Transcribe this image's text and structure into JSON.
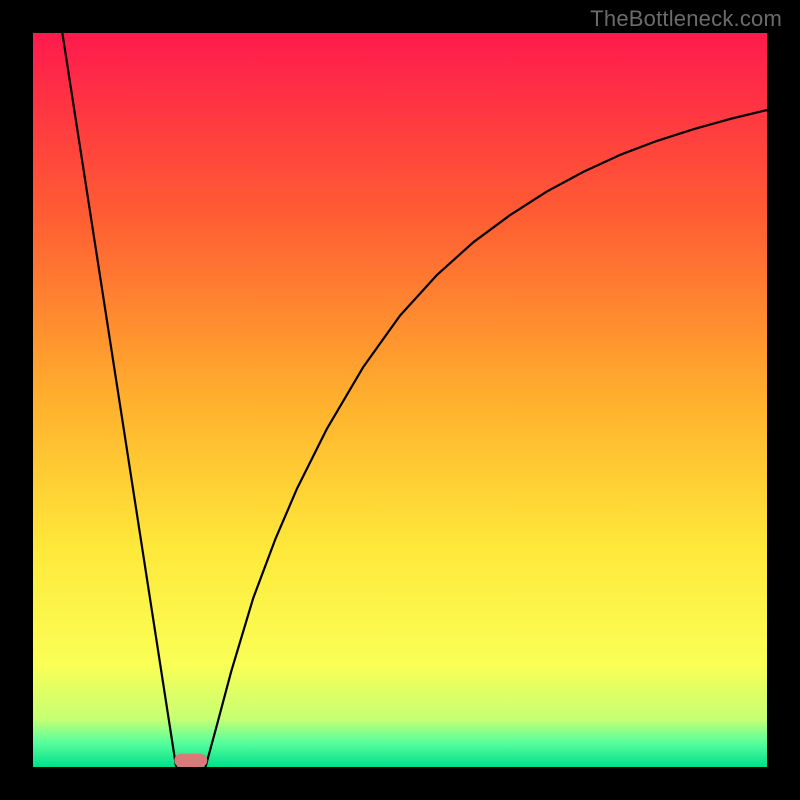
{
  "watermark": "TheBottleneck.com",
  "chart_data": {
    "type": "line",
    "title": "",
    "xlabel": "",
    "ylabel": "",
    "axes_visible": false,
    "xlim": [
      0,
      100
    ],
    "ylim": [
      0,
      100
    ],
    "background": {
      "type": "vertical-gradient",
      "stops": [
        {
          "pos": 0.0,
          "color": "#ff1a4d"
        },
        {
          "pos": 0.25,
          "color": "#ff5d33"
        },
        {
          "pos": 0.5,
          "color": "#ffb02d"
        },
        {
          "pos": 0.7,
          "color": "#ffe83a"
        },
        {
          "pos": 0.86,
          "color": "#faff56"
        },
        {
          "pos": 0.935,
          "color": "#c6ff74"
        },
        {
          "pos": 0.965,
          "color": "#5dff9c"
        },
        {
          "pos": 1.0,
          "color": "#00e08a"
        }
      ]
    },
    "series": [
      {
        "name": "left-segment",
        "color": "#000000",
        "x": [
          4.0,
          19.5
        ],
        "y": [
          100.0,
          0.0
        ]
      },
      {
        "name": "right-curve",
        "color": "#000000",
        "x": [
          23.5,
          25,
          27,
          30,
          33,
          36,
          40,
          45,
          50,
          55,
          60,
          65,
          70,
          75,
          80,
          85,
          90,
          95,
          100
        ],
        "y": [
          0.0,
          5.5,
          13.0,
          23.0,
          31.0,
          38.0,
          46.0,
          54.5,
          61.5,
          67.0,
          71.5,
          75.2,
          78.4,
          81.1,
          83.4,
          85.3,
          86.9,
          88.3,
          89.5
        ]
      }
    ],
    "marker": {
      "name": "min-marker",
      "x": 21.5,
      "y": 0.0,
      "width": 4.5,
      "height": 1.8,
      "color": "#d87a7a"
    }
  }
}
